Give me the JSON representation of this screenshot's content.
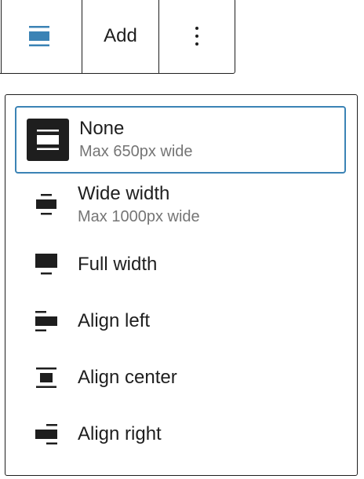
{
  "toolbar": {
    "align_icon": "align-none-icon",
    "add_label": "Add",
    "more_icon": "more-vertical-icon",
    "accent_color": "#3b83b5"
  },
  "menu": {
    "items": [
      {
        "label": "None",
        "sub": "Max 650px wide",
        "icon": "align-none-icon",
        "selected": true
      },
      {
        "label": "Wide width",
        "sub": "Max 1000px wide",
        "icon": "stretch-wide-icon"
      },
      {
        "label": "Full width",
        "icon": "stretch-full-width-icon"
      },
      {
        "label": "Align left",
        "icon": "position-left-icon"
      },
      {
        "label": "Align center",
        "icon": "position-center-icon"
      },
      {
        "label": "Align right",
        "icon": "position-right-icon"
      }
    ],
    "selected_border_color": "#3b83b5"
  }
}
